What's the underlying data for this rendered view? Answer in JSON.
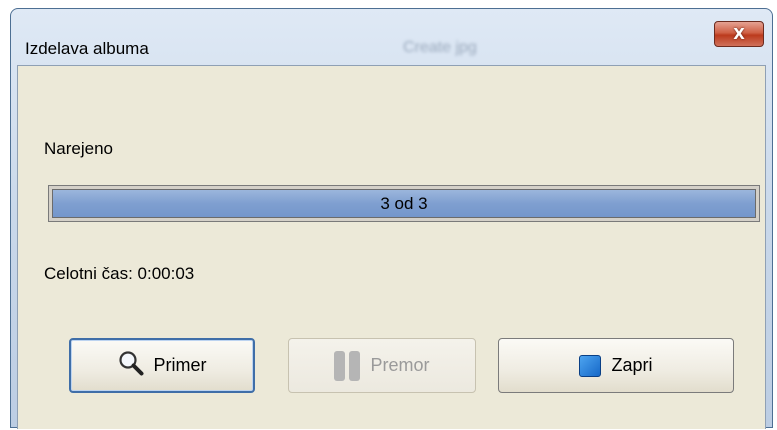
{
  "window": {
    "title": "Izdelava albuma",
    "background_title": "Create jpg",
    "close_label": "X"
  },
  "status": {
    "done_label": "Narejeno",
    "progress_text": "3 od 3",
    "progress_fraction": 1.0,
    "total_time": "Celotni čas: 0:00:03"
  },
  "buttons": {
    "preview": {
      "label": "Primer",
      "icon": "magnifier-icon",
      "enabled": true
    },
    "pause": {
      "label": "Premor",
      "icon": "pause-icon",
      "enabled": false
    },
    "close": {
      "label": "Zapri",
      "icon": "stop-icon",
      "enabled": true
    }
  },
  "colors": {
    "progress_fill": "#7f9fd0",
    "close_button": "#cf6045",
    "dialog_background": "#ece9d8"
  }
}
